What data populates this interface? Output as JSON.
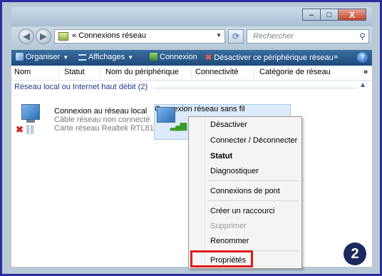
{
  "window": {
    "controls": {
      "minimize": "–",
      "maximize": "□",
      "close": "X"
    }
  },
  "address": {
    "back_icon": "back-arrow",
    "forward_icon": "forward-arrow",
    "prefix": "«",
    "path": "Connexions réseau",
    "refresh_icon": "refresh-arrows",
    "search_placeholder": "Rechercher"
  },
  "toolbar": {
    "organize": "Organiser",
    "views": "Affichages",
    "connect": "Connexion",
    "disable": "Désactiver ce périphérique réseau",
    "more": "»",
    "help": "?"
  },
  "columns": [
    "Nom",
    "Statut",
    "Nom du périphérique",
    "Connectivité",
    "Catégorie de réseau",
    "»"
  ],
  "group": {
    "title": "Réseau local ou Internet haut débit (2)",
    "caret": "▲"
  },
  "items": [
    {
      "name": "Connexion au réseau local",
      "status": "Câble réseau non connecté",
      "device": "Carte réseau Realtek RTL816..."
    },
    {
      "name": "Connexion réseau sans fil"
    }
  ],
  "context_menu": {
    "items": [
      {
        "label": "Désactiver",
        "style": "normal"
      },
      {
        "label": "Connecter / Déconnecter",
        "style": "normal"
      },
      {
        "label": "Statut",
        "style": "bold"
      },
      {
        "label": "Diagnostiquer",
        "style": "normal"
      },
      {
        "label": "Connexions de pont",
        "style": "normal"
      },
      {
        "label": "Créer un raccourci",
        "style": "normal"
      },
      {
        "label": "Supprimer",
        "style": "disabled"
      },
      {
        "label": "Renommer",
        "style": "normal"
      },
      {
        "label": "Propriétés",
        "style": "normal"
      }
    ]
  },
  "step_badge": "2",
  "colors": {
    "background": "#1d1f7e",
    "toolbar": "#2b5d8f",
    "highlight": "#e01b1b",
    "group_text": "#1e3f8a"
  }
}
